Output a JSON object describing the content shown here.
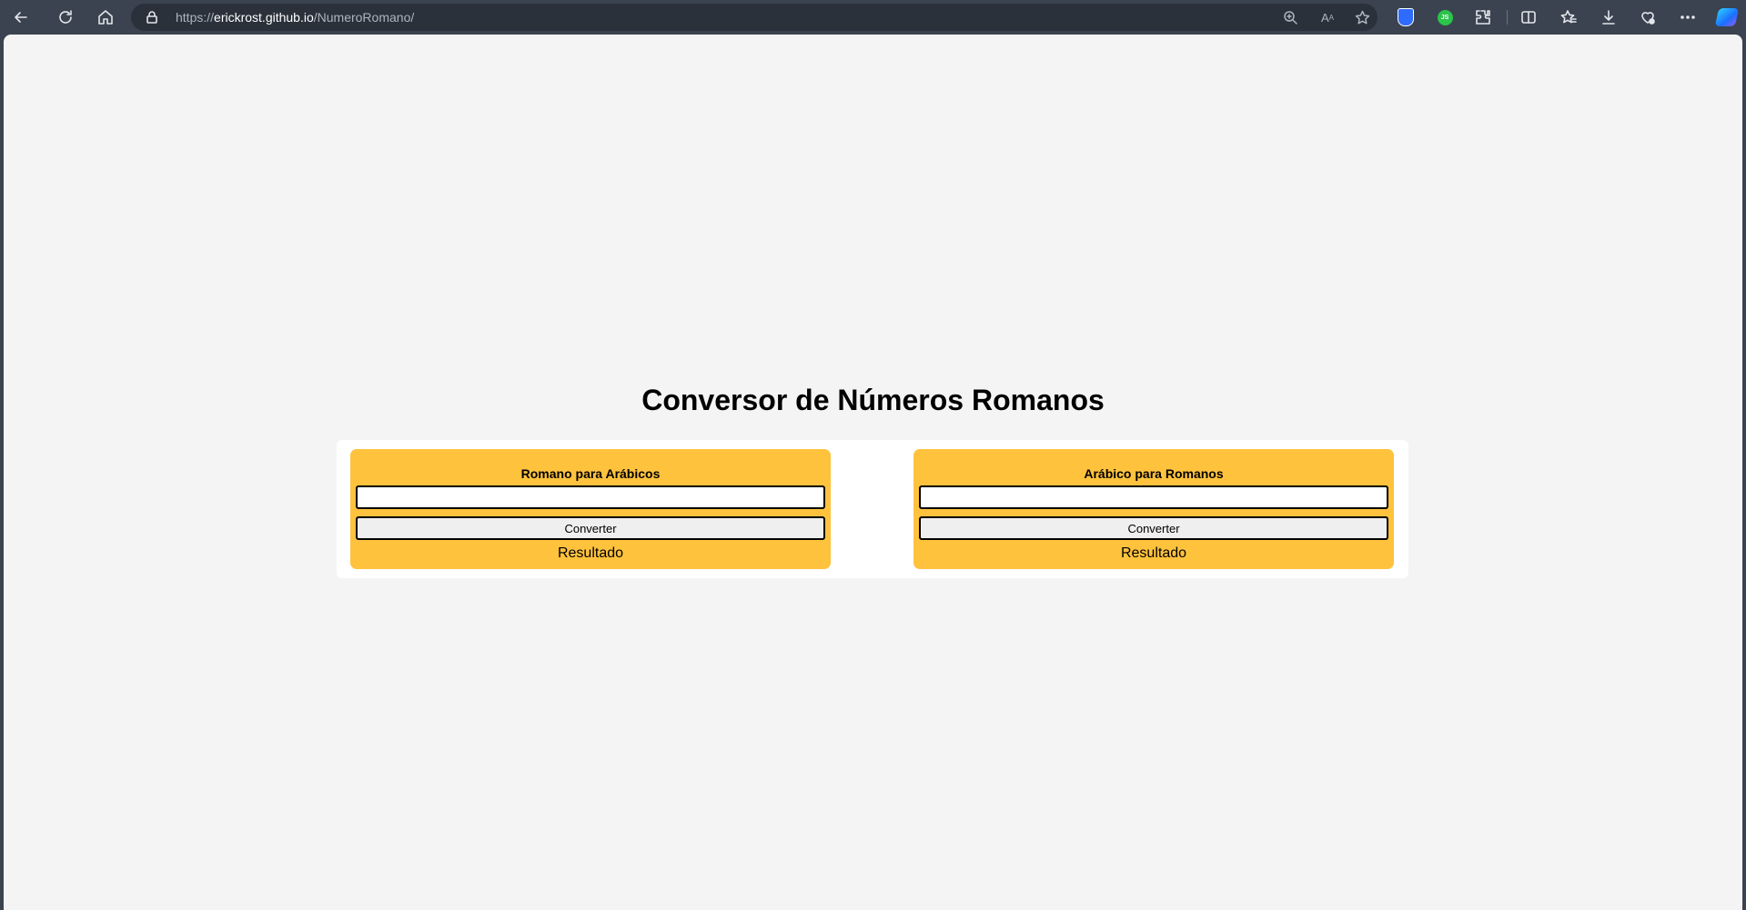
{
  "browser": {
    "url_prefix": "https://",
    "url_host": "erickrost.github.io",
    "url_path": "/NumeroRomano/",
    "read_aloud_label": "A",
    "extension_js_label": "JS",
    "icons": [
      "back-icon",
      "refresh-icon",
      "home-icon",
      "lock-icon",
      "zoom-icon",
      "read-aloud-icon",
      "favorite-star-icon",
      "shield-extension-icon",
      "js-extension-icon",
      "extensions-icon",
      "split-screen-icon",
      "favorites-icon",
      "downloads-icon",
      "browser-essentials-icon",
      "more-icon",
      "copilot-icon"
    ]
  },
  "page": {
    "title": "Conversor de Números Romanos",
    "converters": [
      {
        "title": "Romano para Arábicos",
        "input_value": "",
        "button_label": "Converter",
        "result": "Resultado"
      },
      {
        "title": "Arábico para Romanos",
        "input_value": "",
        "button_label": "Converter",
        "result": "Resultado"
      }
    ]
  },
  "colors": {
    "chrome_background": "#3b4350",
    "page_background": "#f4f4f4",
    "panel_background": "#ffffff",
    "card_background": "#ffc23d"
  }
}
